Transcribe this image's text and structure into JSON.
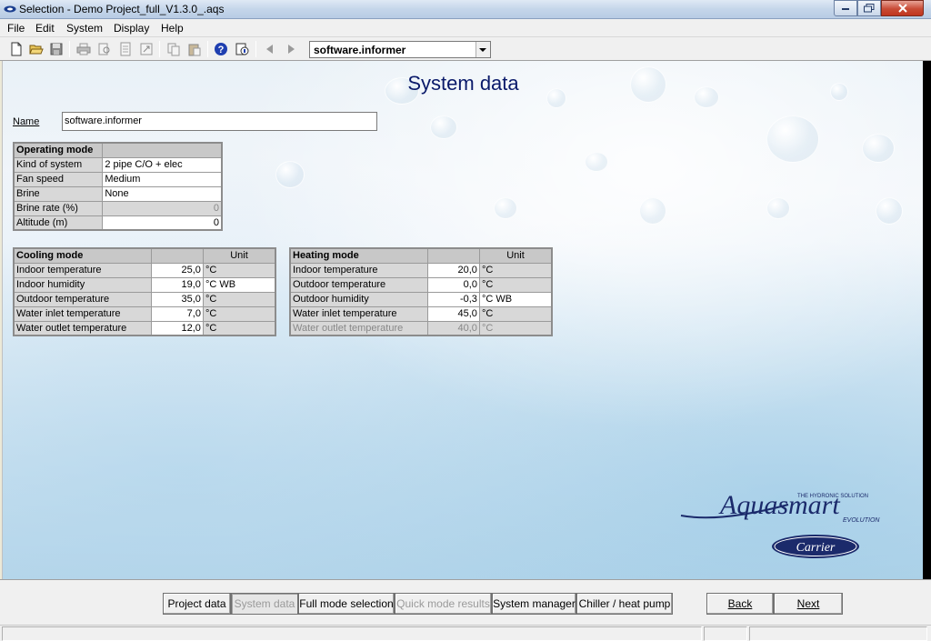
{
  "window": {
    "title": "Selection - Demo Project_full_V1.3.0_.aqs"
  },
  "menu": [
    "File",
    "Edit",
    "System",
    "Display",
    "Help"
  ],
  "toolbar": {
    "icons": [
      "new-file-icon",
      "open-folder-icon",
      "save-icon",
      "print-icon",
      "print-preview-icon",
      "report-icon",
      "export-icon",
      "copy-icon",
      "paste-icon",
      "help-icon",
      "info-icon",
      "back-arrow-icon",
      "forward-arrow-icon"
    ],
    "project_selected": "software.informer"
  },
  "page": {
    "title": "System data",
    "name_label": "Name",
    "name_value": "software.informer"
  },
  "operating_mode": {
    "header": "Operating mode",
    "rows": [
      {
        "label": "Kind of system",
        "value": "2 pipe C/O + elec"
      },
      {
        "label": "Fan speed",
        "value": "Medium"
      },
      {
        "label": "Brine",
        "value": "None"
      },
      {
        "label": "Brine rate (%)",
        "value": "0"
      },
      {
        "label": "Altitude (m)",
        "value": "0"
      }
    ]
  },
  "cooling_mode": {
    "header": "Cooling mode",
    "unit_header": "Unit",
    "rows": [
      {
        "label": "Indoor temperature",
        "value": "25,0",
        "unit": "°C"
      },
      {
        "label": "Indoor humidity",
        "value": "19,0",
        "unit": "°C WB"
      },
      {
        "label": "Outdoor temperature",
        "value": "35,0",
        "unit": "°C"
      },
      {
        "label": "Water inlet temperature",
        "value": "7,0",
        "unit": "°C"
      },
      {
        "label": "Water outlet temperature",
        "value": "12,0",
        "unit": "°C"
      }
    ]
  },
  "heating_mode": {
    "header": "Heating mode",
    "unit_header": "Unit",
    "rows": [
      {
        "label": "Indoor temperature",
        "value": "20,0",
        "unit": "°C"
      },
      {
        "label": "Outdoor temperature",
        "value": "0,0",
        "unit": "°C"
      },
      {
        "label": "Outdoor humidity",
        "value": "-0,3",
        "unit": "°C WB"
      },
      {
        "label": "Water inlet temperature",
        "value": "45,0",
        "unit": "°C"
      },
      {
        "label": "Water outlet temperature",
        "value": "40,0",
        "unit": "°C"
      }
    ]
  },
  "logo": {
    "brand": "Aquasmart",
    "tagline": "THE HYDRONIC SOLUTION",
    "sub": "EVOLUTION",
    "maker": "Carrier"
  },
  "nav": {
    "project_data": "Project data",
    "system_data": "System data",
    "full_mode_selection": "Full mode selection",
    "quick_mode_results": "Quick mode results",
    "system_manager": "System manager",
    "chiller_heat_pump": "Chiller / heat pump",
    "back": "Back",
    "next": "Next"
  },
  "colors": {
    "title_blue": "#0a1a6a",
    "logo_navy": "#1b2a6b",
    "close_red": "#c84b35"
  }
}
